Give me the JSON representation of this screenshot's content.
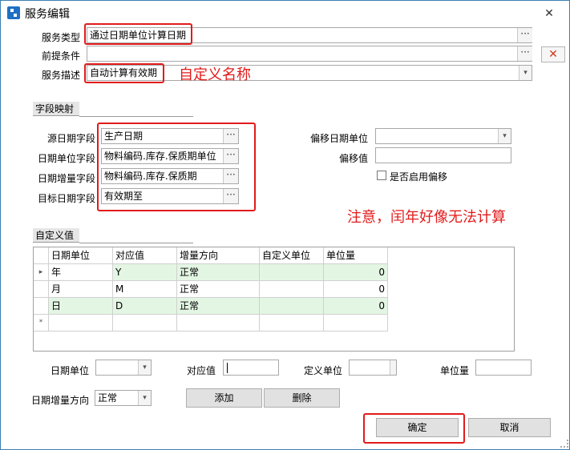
{
  "window": {
    "title": "服务编辑",
    "close_glyph": "✕"
  },
  "form": {
    "service_type_label": "服务类型",
    "service_type_value": "通过日期单位计算日期",
    "precondition_label": "前提条件",
    "precondition_value": "",
    "service_desc_label": "服务描述",
    "service_desc_value": "自动计算有效期"
  },
  "mapping": {
    "section_title": "字段映射",
    "source_date_label": "源日期字段",
    "source_date_value": "生产日期",
    "date_unit_label": "日期单位字段",
    "date_unit_value": "物料编码.库存.保质期单位",
    "date_increment_label": "日期增量字段",
    "date_increment_value": "物料编码.库存.保质期",
    "target_date_label": "目标日期字段",
    "target_date_value": "有效期至",
    "offset_unit_label": "偏移日期单位",
    "offset_unit_value": "",
    "offset_value_label": "偏移值",
    "offset_value": "",
    "enable_offset_label": "是否启用偏移"
  },
  "custom": {
    "section_title": "自定义值",
    "columns": [
      "日期单位",
      "对应值",
      "增量方向",
      "自定义单位",
      "单位量"
    ],
    "rows": [
      {
        "unit": "年",
        "value": "Y",
        "direction": "正常",
        "custom_unit": "",
        "amount": "0"
      },
      {
        "unit": "月",
        "value": "M",
        "direction": "正常",
        "custom_unit": "",
        "amount": "0"
      },
      {
        "unit": "日",
        "value": "D",
        "direction": "正常",
        "custom_unit": "",
        "amount": "0"
      }
    ],
    "new_row_marker": "*",
    "current_row_marker": "▸"
  },
  "editor": {
    "date_unit_label": "日期单位",
    "date_unit_value": "",
    "value_label": "对应值",
    "value_value": "",
    "custom_unit_label": "定义单位",
    "custom_unit_value": "",
    "amount_label": "单位量",
    "amount_value": "",
    "direction_label": "日期增量方向",
    "direction_value": "正常",
    "add_button": "添加",
    "delete_button": "删除"
  },
  "footer": {
    "ok_button": "确定",
    "cancel_button": "取消"
  },
  "annotations": {
    "custom_name": "自定义名称",
    "leap_year_note": "注意，闰年好像无法计算"
  },
  "icons": {
    "ellipsis": "···",
    "dropdown": "▾",
    "clear": "✕"
  },
  "colors": {
    "annotation_red": "#e21b1b",
    "row_highlight": "#e3f6e3",
    "window_border": "#3c7fb1"
  }
}
